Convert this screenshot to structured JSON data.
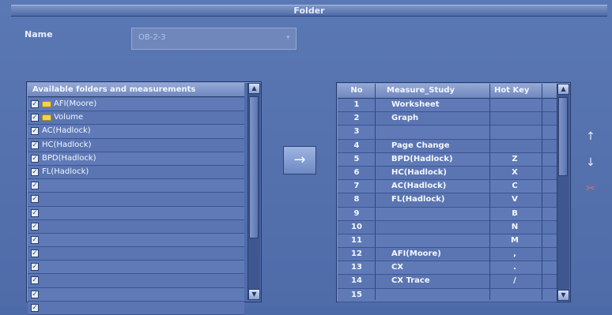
{
  "window": {
    "title": "Folder"
  },
  "name_field": {
    "label": "Name",
    "value": "OB-2-3"
  },
  "left_list": {
    "header": "Available folders and measurements",
    "items": [
      {
        "label": "AFI(Moore)",
        "checked": true,
        "folder": true,
        "faded": false
      },
      {
        "label": "Volume",
        "checked": true,
        "folder": true,
        "faded": false
      },
      {
        "label": "AC(Hadlock)",
        "checked": true,
        "folder": false,
        "faded": false
      },
      {
        "label": "HC(Hadlock)",
        "checked": true,
        "folder": false,
        "faded": false
      },
      {
        "label": "BPD(Hadlock)",
        "checked": true,
        "folder": false,
        "faded": false
      },
      {
        "label": "FL(Hadlock)",
        "checked": true,
        "folder": false,
        "faded": false
      },
      {
        "label": "",
        "checked": true,
        "folder": false,
        "faded": true
      },
      {
        "label": "",
        "checked": true,
        "folder": false,
        "faded": true
      },
      {
        "label": "",
        "checked": true,
        "folder": false,
        "faded": true
      },
      {
        "label": "",
        "checked": true,
        "folder": false,
        "faded": true
      },
      {
        "label": "",
        "checked": true,
        "folder": false,
        "faded": true
      },
      {
        "label": "",
        "checked": true,
        "folder": false,
        "faded": true
      },
      {
        "label": "",
        "checked": true,
        "folder": false,
        "faded": true
      },
      {
        "label": "",
        "checked": true,
        "folder": false,
        "faded": true
      },
      {
        "label": "",
        "checked": true,
        "folder": false,
        "faded": true
      },
      {
        "label": "",
        "checked": true,
        "folder": false,
        "faded": true
      }
    ]
  },
  "right_table": {
    "columns": {
      "no": "No",
      "measure": "Measure_Study",
      "hotkey": "Hot Key"
    },
    "rows": [
      {
        "no": "1",
        "measure": "Worksheet",
        "hotkey": ""
      },
      {
        "no": "2",
        "measure": "Graph",
        "hotkey": ""
      },
      {
        "no": "3",
        "measure": "",
        "hotkey": ""
      },
      {
        "no": "4",
        "measure": "Page Change",
        "hotkey": ""
      },
      {
        "no": "5",
        "measure": "BPD(Hadlock)",
        "hotkey": "Z"
      },
      {
        "no": "6",
        "measure": "HC(Hadlock)",
        "hotkey": "X"
      },
      {
        "no": "7",
        "measure": "AC(Hadlock)",
        "hotkey": "C"
      },
      {
        "no": "8",
        "measure": "FL(Hadlock)",
        "hotkey": "V"
      },
      {
        "no": "9",
        "measure": "",
        "hotkey": "B"
      },
      {
        "no": "10",
        "measure": "",
        "hotkey": "N"
      },
      {
        "no": "11",
        "measure": "",
        "hotkey": "M"
      },
      {
        "no": "12",
        "measure": "AFI(Moore)",
        "hotkey": ","
      },
      {
        "no": "13",
        "measure": "CX",
        "hotkey": "."
      },
      {
        "no": "14",
        "measure": "CX Trace",
        "hotkey": "/"
      },
      {
        "no": "15",
        "measure": "",
        "hotkey": ""
      }
    ]
  },
  "buttons": {
    "add_arrow": "→",
    "move_up": "↑",
    "move_down": "↓",
    "cut": "✂"
  },
  "icons": {
    "scroll_up": "▲",
    "scroll_down": "▼",
    "dropdown": "▾"
  }
}
